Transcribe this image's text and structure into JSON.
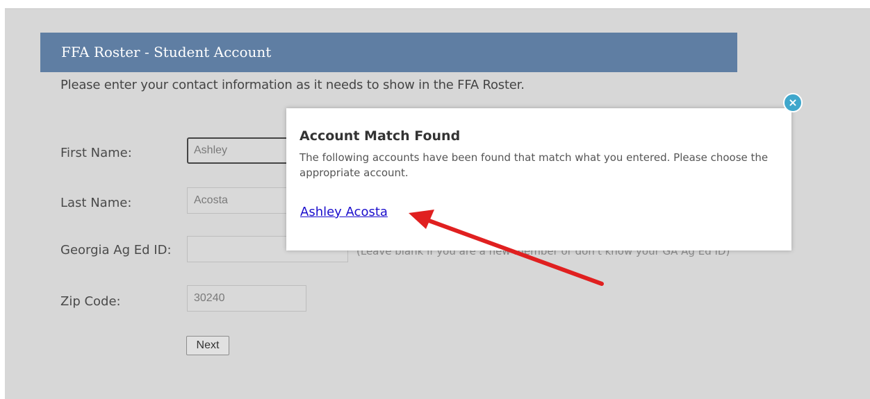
{
  "header": {
    "title": "FFA Roster - Student Account"
  },
  "intro_text": "Please enter your contact information as it needs to show in the FFA Roster.",
  "form": {
    "first_name_label": "First Name:",
    "first_name_value": "Ashley",
    "last_name_label": "Last Name:",
    "last_name_value": "Acosta",
    "ag_ed_id_label": "Georgia Ag Ed ID:",
    "ag_ed_id_value": "",
    "ag_ed_id_hint": "(Leave blank if you are a new member or don't know your GA Ag Ed ID)",
    "zip_label": "Zip Code:",
    "zip_value": "30240",
    "next_label": "Next"
  },
  "modal": {
    "title": "Account Match Found",
    "message": "The following accounts have been found that match what you entered. Please choose the appropriate account.",
    "accounts": [
      "Ashley Acosta"
    ],
    "close_icon": "×"
  },
  "colors": {
    "title_bar": "#5f7ea3",
    "arrow": "#e02020",
    "close": "#3fa7cc",
    "link": "#1a0dcc"
  }
}
